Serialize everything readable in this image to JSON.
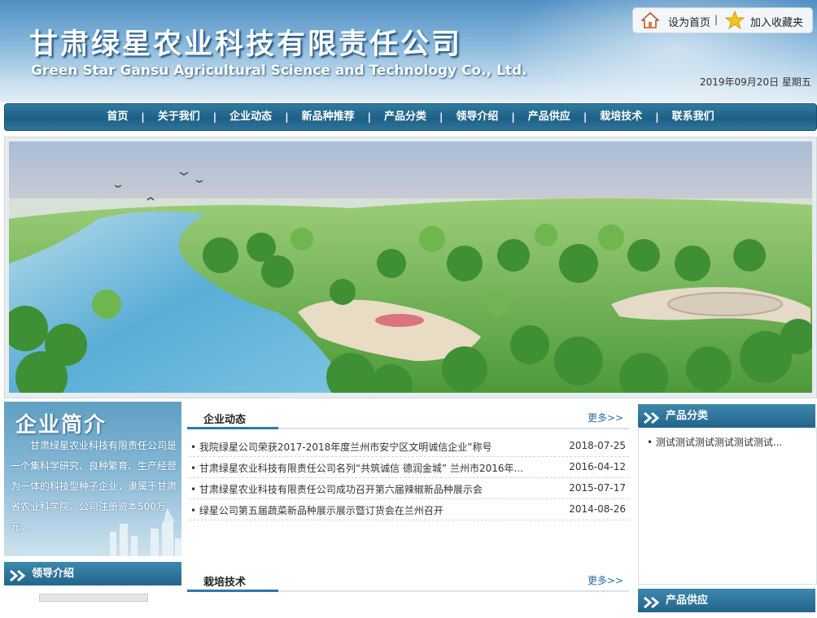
{
  "header": {
    "title_cn": "甘肃绿星农业科技有限责任公司",
    "title_en": "Green Star Gansu Agricultural Science and Technology Co., Ltd.",
    "set_home": "设为首页",
    "add_fav": "加入收藏夹",
    "separator": "|",
    "date": "2019年09月20日 星期五"
  },
  "nav": {
    "items": [
      "首页",
      "关于我们",
      "企业动态",
      "新品种推荐",
      "产品分类",
      "领导介绍",
      "产品供应",
      "栽培技术",
      "联系我们"
    ],
    "separator": "|"
  },
  "intro": {
    "title": "企业简介",
    "text": "甘肃绿星农业科技有限责任公司是一个集科学研究、良种繁育、生产经营为一体的科技型种子企业，隶属于甘肃省农业科学院。公司注册资本500万元。"
  },
  "leaders": {
    "title": "领导介绍"
  },
  "news": {
    "title": "企业动态",
    "more": "更多>>",
    "items": [
      {
        "title": "• 我院绿星公司荣获2017-2018年度兰州市安宁区文明诚信企业”称号",
        "date": "2018-07-25"
      },
      {
        "title": "• 甘肃绿星农业科技有限责任公司名列“共筑诚信 德润金城” 兰州市2016年...",
        "date": "2016-04-12"
      },
      {
        "title": "• 甘肃绿星农业科技有限责任公司成功召开第六届辣椒新品种展示会",
        "date": "2015-07-17"
      },
      {
        "title": "• 绿星公司第五届蔬菜新品种展示展示暨订货会在兰州召开",
        "date": "2014-08-26"
      }
    ]
  },
  "cultivation": {
    "title": "栽培技术",
    "more": "更多>>"
  },
  "products": {
    "title": "产品分类",
    "items": [
      "• 测试测试测试测试测试测试..."
    ]
  },
  "supply": {
    "title": "产品供应"
  },
  "icons": {
    "home": "home-icon",
    "star": "star-icon",
    "arrows": "double-chevron-icon"
  },
  "colors": {
    "nav_bg": "#23648c",
    "accent": "#2a7ca6",
    "header_top": "#4f8fc4"
  }
}
